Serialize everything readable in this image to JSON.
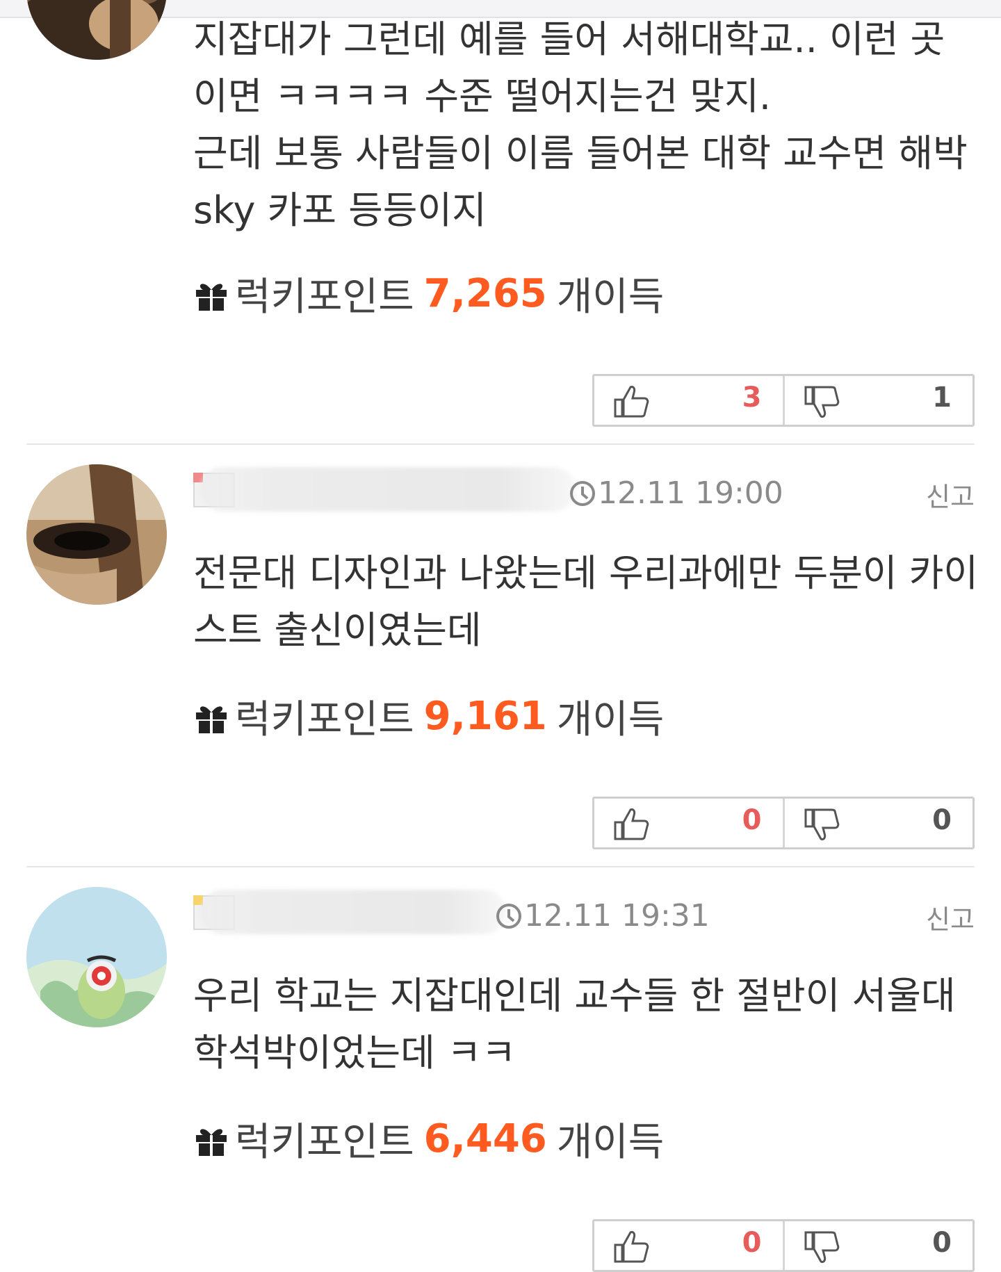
{
  "comments": [
    {
      "body": "지잡대가 그런데 예를 들어 서해대학교.. 이런 곳이면 ㅋㅋㅋㅋ 수준 떨어지는건 맞지.\n근데 보통 사람들이 이름 들어본 대학 교수면 해박 sky 카포 등등이지",
      "lucky_label": "럭키포인트",
      "lucky_points": "7,265",
      "lucky_suffix": "개이득",
      "upvotes": "3",
      "downvotes": "1"
    },
    {
      "time": "12.11 19:00",
      "report": "신고",
      "body": "전문대 디자인과 나왔는데 우리과에만 두분이 카이스트 출신이였는데",
      "lucky_label": "럭키포인트",
      "lucky_points": "9,161",
      "lucky_suffix": "개이득",
      "upvotes": "0",
      "downvotes": "0"
    },
    {
      "time": "12.11 19:31",
      "report": "신고",
      "body": "우리 학교는 지잡대인데 교수들 한 절반이 서울대 학석박이었는데 ㅋㅋ",
      "lucky_label": "럭키포인트",
      "lucky_points": "6,446",
      "lucky_suffix": "개이득",
      "upvotes": "0",
      "downvotes": "0"
    }
  ],
  "icons": {
    "gift": "gift-icon",
    "clock": "clock-icon",
    "thumbs_up": "thumbs-up-icon",
    "thumbs_down": "thumbs-down-icon"
  },
  "colors": {
    "points": "#ff5a1f",
    "upvote_count": "#e85b5b"
  }
}
